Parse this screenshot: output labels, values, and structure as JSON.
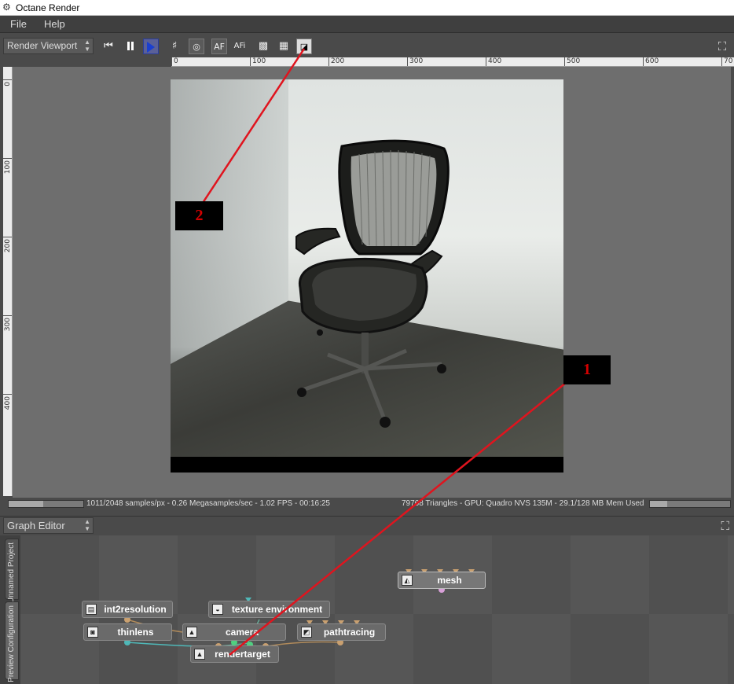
{
  "window": {
    "title": "Octane Render",
    "icon": "gear-icon"
  },
  "menu": {
    "items": [
      "File",
      "Help"
    ]
  },
  "toolbar": {
    "view_select": "Render Viewport",
    "buttons": [
      {
        "name": "skip-to-start-icon",
        "glyph": "⏮"
      },
      {
        "name": "pause-icon",
        "glyph": ""
      },
      {
        "name": "play-icon",
        "glyph": ""
      },
      {
        "name": "grid-icon",
        "glyph": "♯"
      },
      {
        "name": "camera-focus-icon",
        "glyph": "◎"
      },
      {
        "name": "autofocus-button",
        "glyph": "AF"
      },
      {
        "name": "autofocus-info-button",
        "glyph": "AFi"
      },
      {
        "name": "alpha-icon",
        "glyph": "▩"
      },
      {
        "name": "checker-icon",
        "glyph": "▦"
      },
      {
        "name": "region-icon",
        "glyph": "◪"
      }
    ]
  },
  "ruler": {
    "h_labels": [
      "0",
      "100",
      "200",
      "300",
      "400",
      "500",
      "600",
      "70"
    ],
    "v_labels": [
      "0",
      "100",
      "200",
      "300",
      "400"
    ]
  },
  "status": {
    "left_text": "1011/2048 samples/px - 0.26 Megasamples/sec - 1.02 FPS - 00:16:25",
    "right_text": "79768 Triangles - GPU: Quadro NVS 135M - 29.1/128 MB Mem Used",
    "progress_left": 0.46,
    "progress_right": 0.22
  },
  "graph_editor": {
    "select_label": "Graph Editor",
    "tabs": [
      "Unnamed Project",
      "Preview Configuration"
    ],
    "nodes": [
      {
        "id": "mesh",
        "label": "mesh",
        "icon": "mesh-icon"
      },
      {
        "id": "int2resolution",
        "label": "int2resolution",
        "icon": "resolution-icon"
      },
      {
        "id": "texture_env",
        "label": "texture environment",
        "icon": "environment-icon"
      },
      {
        "id": "thinlens",
        "label": "thinlens",
        "icon": "camera-icon"
      },
      {
        "id": "camera",
        "label": "camera",
        "icon": "image-icon"
      },
      {
        "id": "pathtracing",
        "label": "pathtracing",
        "icon": "kernel-icon"
      },
      {
        "id": "rendertarget",
        "label": "rendertarget",
        "icon": "image-icon"
      }
    ]
  },
  "annotations": {
    "callout1": "1",
    "callout2": "2",
    "color": "#d40000"
  }
}
